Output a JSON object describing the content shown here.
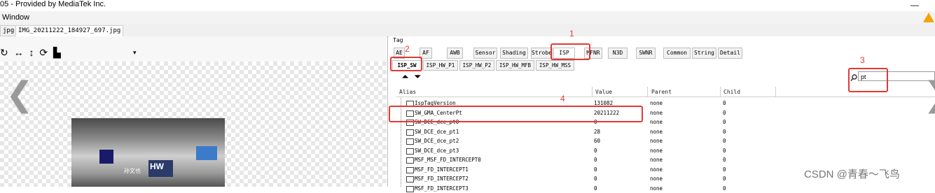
{
  "window": {
    "title": "05 - Provided by MediaTek Inc.",
    "minimize": "—"
  },
  "menu": {
    "items": [
      "Window"
    ]
  },
  "file_tabs": [
    "jpg",
    "IMG_20211222_184927_697.jpg"
  ],
  "left_toolbar": {
    "rotate_left": "↻",
    "flip_h": "↔",
    "flip_v": "↕",
    "refresh": "⟳",
    "histogram": "▙",
    "dropdown": "▾"
  },
  "nav": {
    "prev": "❮",
    "next": "❯"
  },
  "photo_text": {
    "sign_left": "孙文也",
    "sign_right": "HW"
  },
  "tag_label": "Tag",
  "tag_tabs": [
    "AE",
    "AF",
    "AWB",
    "Sensor",
    "Shading",
    "Strobe",
    "ISP",
    "MFNR",
    "N3D",
    "SWNR",
    "Common",
    "String",
    "Detail"
  ],
  "sub_tabs": [
    "ISP_SW",
    "ISP_HW_P1",
    "ISP_HW_P2",
    "ISP_HW_MFB",
    "ISP_HW_MSS"
  ],
  "expand_icons": {
    "collapse": "⏶",
    "expand": "⏷"
  },
  "search": {
    "value": "pt"
  },
  "columns": [
    "Alias",
    "Value",
    "Parent",
    "Child"
  ],
  "rows": [
    {
      "alias": "IspTagVersion",
      "value": "131082",
      "parent": "none",
      "child": "0"
    },
    {
      "alias": "SW_GMA_CenterPt",
      "value": "20211222",
      "parent": "none",
      "child": "0"
    },
    {
      "alias": "SW_DCE_dce_pt0",
      "value": "0",
      "parent": "none",
      "child": "0"
    },
    {
      "alias": "SW_DCE_dce_pt1",
      "value": "28",
      "parent": "none",
      "child": "0"
    },
    {
      "alias": "SW_DCE_dce_pt2",
      "value": "60",
      "parent": "none",
      "child": "0"
    },
    {
      "alias": "SW_DCE_dce_pt3",
      "value": "0",
      "parent": "none",
      "child": "0"
    },
    {
      "alias": "MSF_MSF_FD_INTERCEPT0",
      "value": "0",
      "parent": "none",
      "child": "0"
    },
    {
      "alias": "MSF_FD_INTERCEPT1",
      "value": "0",
      "parent": "none",
      "child": "0"
    },
    {
      "alias": "MSF_FD_INTERCEPT2",
      "value": "0",
      "parent": "none",
      "child": "0"
    },
    {
      "alias": "MSF_FD_INTERCEPT3",
      "value": "0",
      "parent": "none",
      "child": "0"
    }
  ],
  "annotations": [
    "1",
    "2",
    "3",
    "4"
  ],
  "watermark": "CSDN @青春～飞鸟",
  "colors": {
    "annotation_red": "#e53935",
    "logo_orange": "#f5a300"
  }
}
